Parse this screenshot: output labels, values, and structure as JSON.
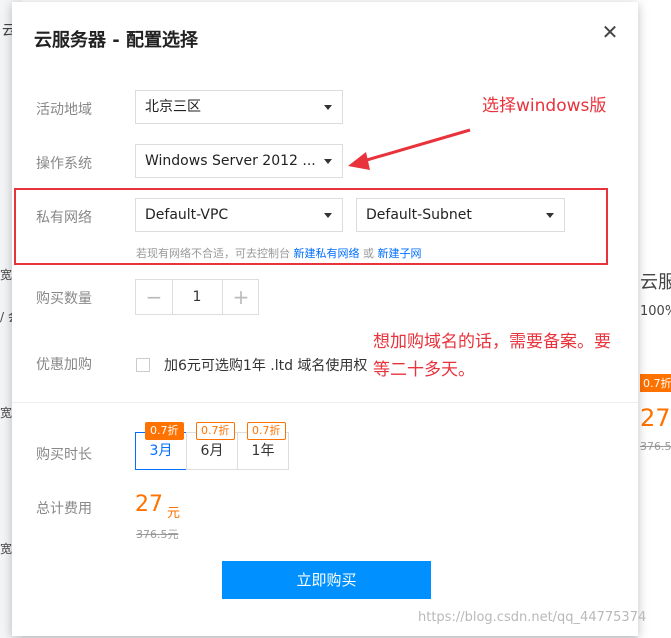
{
  "background": {
    "left_fragments": [
      "云",
      "宽 /",
      "/ 会",
      "宽",
      "宽"
    ],
    "right_title": "云服",
    "right_pct": "100%",
    "right_badge": "0.7折",
    "right_price": "27",
    "right_strike": "376.5"
  },
  "dialog": {
    "title": "云服务器 - 配置选择",
    "close_icon": "close-icon"
  },
  "form": {
    "region_label": "活动地域",
    "region_value": "北京三区",
    "os_label": "操作系统",
    "os_value": "Windows Server 2012 ...",
    "network_label": "私有网络",
    "vpc_value": "Default-VPC",
    "subnet_value": "Default-Subnet",
    "network_hint_prefix": "若现有网络不合适，可去控制台",
    "network_hint_link1": "新建私有网络",
    "network_hint_or": "或",
    "network_hint_link2": "新建子网",
    "quantity_label": "购买数量",
    "quantity_minus": "−",
    "quantity_value": "1",
    "quantity_plus": "+",
    "addon_label": "优惠加购",
    "addon_text": "加6元可选购1年 .ltd 域名使用权",
    "duration_label": "购买时长",
    "durations": [
      {
        "label": "3月",
        "badge": "0.7折",
        "selected": true
      },
      {
        "label": "6月",
        "badge": "0.7折",
        "selected": false
      },
      {
        "label": "1年",
        "badge": "0.7折",
        "selected": false
      }
    ],
    "total_label": "总计费用",
    "total_price": "27",
    "total_unit": "元",
    "original_price": "376.5元",
    "buy_button": "立即购买"
  },
  "annotations": {
    "os_note": "选择windows版",
    "domain_note_line1": "想加购域名的话，需要备案。要",
    "domain_note_line2": "等二十多天。"
  },
  "watermark": "https://blog.csdn.net/qq_44775374",
  "colors": {
    "accent": "#006eff",
    "buy_button": "#0090ff",
    "price": "#ff7200",
    "annotation": "#e8323c"
  }
}
